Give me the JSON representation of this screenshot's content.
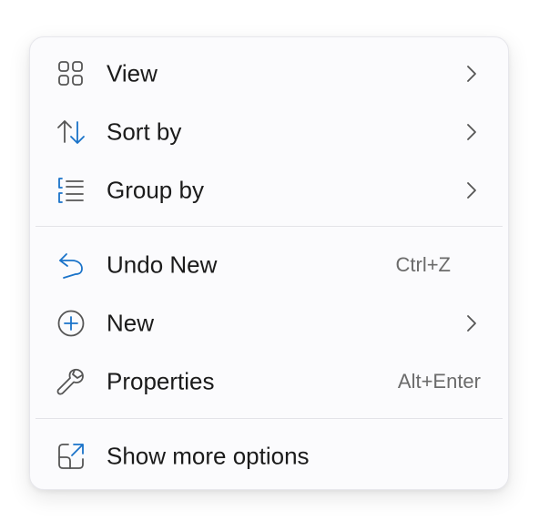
{
  "menu": {
    "items": [
      {
        "label": "View",
        "icon": "grid-icon",
        "submenu": true
      },
      {
        "label": "Sort by",
        "icon": "sort-arrows-icon",
        "submenu": true
      },
      {
        "label": "Group by",
        "icon": "group-list-icon",
        "submenu": true
      },
      {
        "label": "Undo New",
        "icon": "undo-icon",
        "shortcut": "Ctrl+Z"
      },
      {
        "label": "New",
        "icon": "add-circle-icon",
        "submenu": true
      },
      {
        "label": "Properties",
        "icon": "wrench-icon",
        "shortcut": "Alt+Enter"
      },
      {
        "label": "Show more options",
        "icon": "open-external-icon"
      }
    ]
  },
  "colors": {
    "accent": "#1a73c9",
    "icon_gray": "#555555",
    "text": "#1b1b1b",
    "shortcut_text": "#6b6b6b",
    "menu_bg": "#fbfbfd",
    "separator": "#e3e3e8"
  }
}
